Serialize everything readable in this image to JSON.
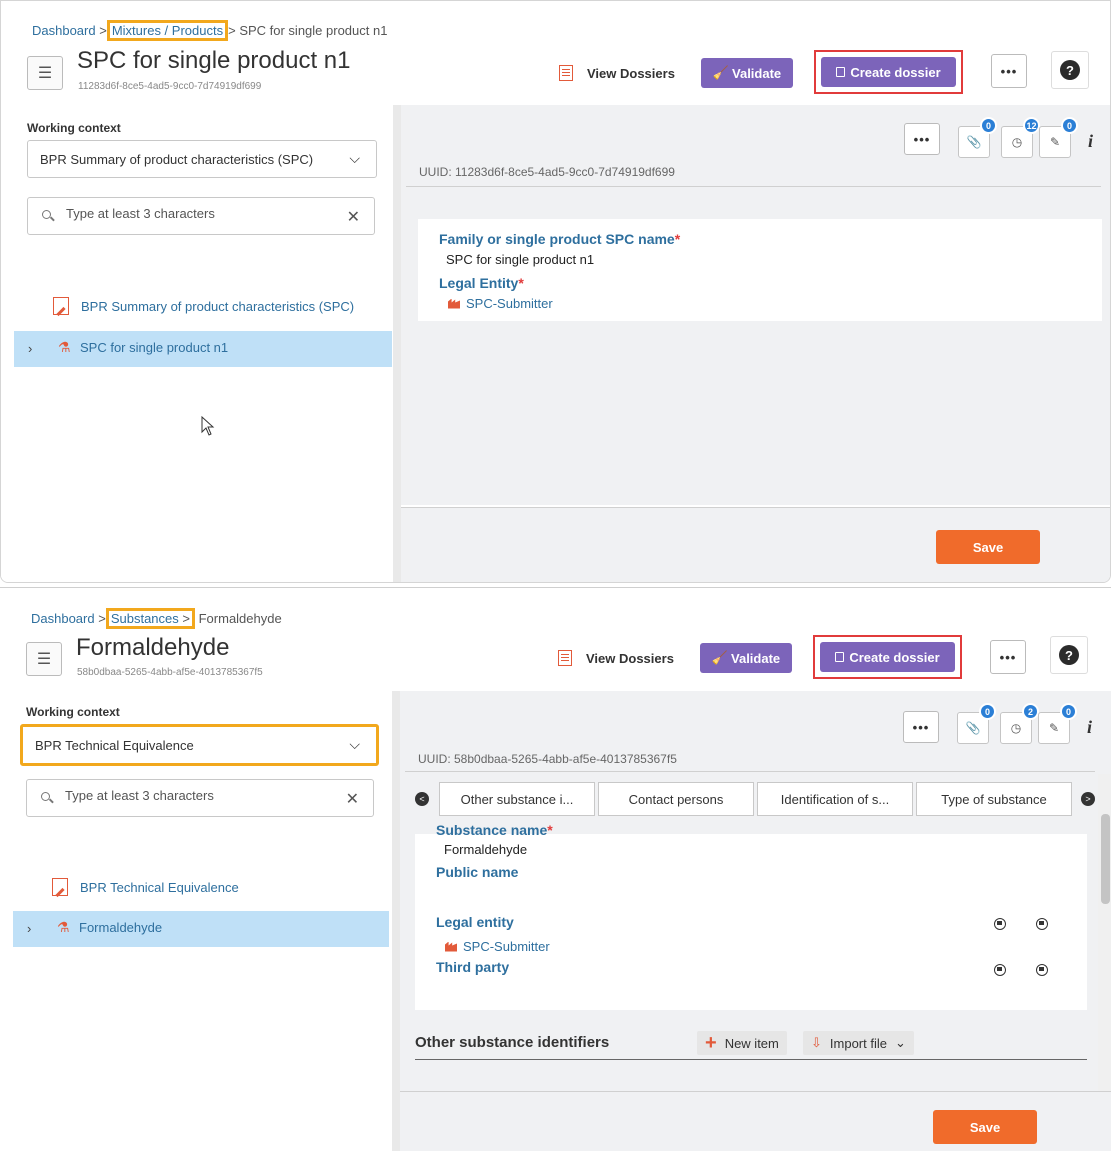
{
  "panel1": {
    "breadcrumb": {
      "dashboard": "Dashboard",
      "sep1": ">",
      "middle": "Mixtures / Products",
      "sep2": ">",
      "current": "SPC for single product n1"
    },
    "title": "SPC for single product n1",
    "uuid_sub": "11283d6f-8ce5-4ad5-9cc0-7d74919df699",
    "view_dossiers": "View Dossiers",
    "validate": "Validate",
    "create_dossier": "Create dossier",
    "more": "•••",
    "help": "?",
    "working_context_label": "Working context",
    "working_context_value": "BPR Summary of product characteristics (SPC)",
    "search_placeholder": "Type at least 3 characters",
    "tree_root": "BPR Summary of product characteristics (SPC)",
    "tree_selected": "SPC for single product n1",
    "badges": {
      "attachments": "0",
      "history": "12",
      "annotations": "0"
    },
    "uuid_line": "UUID: 11283d6f-8ce5-4ad5-9cc0-7d74919df699",
    "fields": {
      "family_label": "Family or single product SPC name",
      "family_value": "SPC for single product n1",
      "legal_entity_label": "Legal Entity",
      "legal_entity_value": "SPC-Submitter"
    },
    "save": "Save"
  },
  "panel2": {
    "breadcrumb": {
      "dashboard": "Dashboard",
      "sep1": ">",
      "middle": "Substances",
      "sep2": ">",
      "current": "Formaldehyde"
    },
    "title": "Formaldehyde",
    "uuid_sub": "58b0dbaa-5265-4abb-af5e-4013785367f5",
    "view_dossiers": "View Dossiers",
    "validate": "Validate",
    "create_dossier": "Create dossier",
    "more": "•••",
    "help": "?",
    "working_context_label": "Working context",
    "working_context_value": "BPR Technical Equivalence",
    "search_placeholder": "Type at least 3 characters",
    "tree_root": "BPR Technical Equivalence",
    "tree_selected": "Formaldehyde",
    "badges": {
      "attachments": "0",
      "history": "2",
      "annotations": "0"
    },
    "uuid_line": "UUID: 58b0dbaa-5265-4abb-af5e-4013785367f5",
    "tabs": [
      "Other substance i...",
      "Contact persons",
      "Identification of s...",
      "Type of substance"
    ],
    "fields": {
      "substance_name_label": "Substance name",
      "substance_name_value": "Formaldehyde",
      "public_name_label": "Public name",
      "legal_entity_label": "Legal entity",
      "legal_entity_value": "SPC-Submitter",
      "third_party_label": "Third party"
    },
    "section_title": "Other substance identifiers",
    "new_item": "New item",
    "import_file": "Import file",
    "save": "Save"
  },
  "colors": {
    "accent_purple": "#7c64ba",
    "save_orange": "#f06b2b",
    "highlight_yellow": "#f2a81d",
    "highlight_red": "#e13b3b",
    "link_blue": "#2e6f9e",
    "selection": "#bfe0f7"
  }
}
